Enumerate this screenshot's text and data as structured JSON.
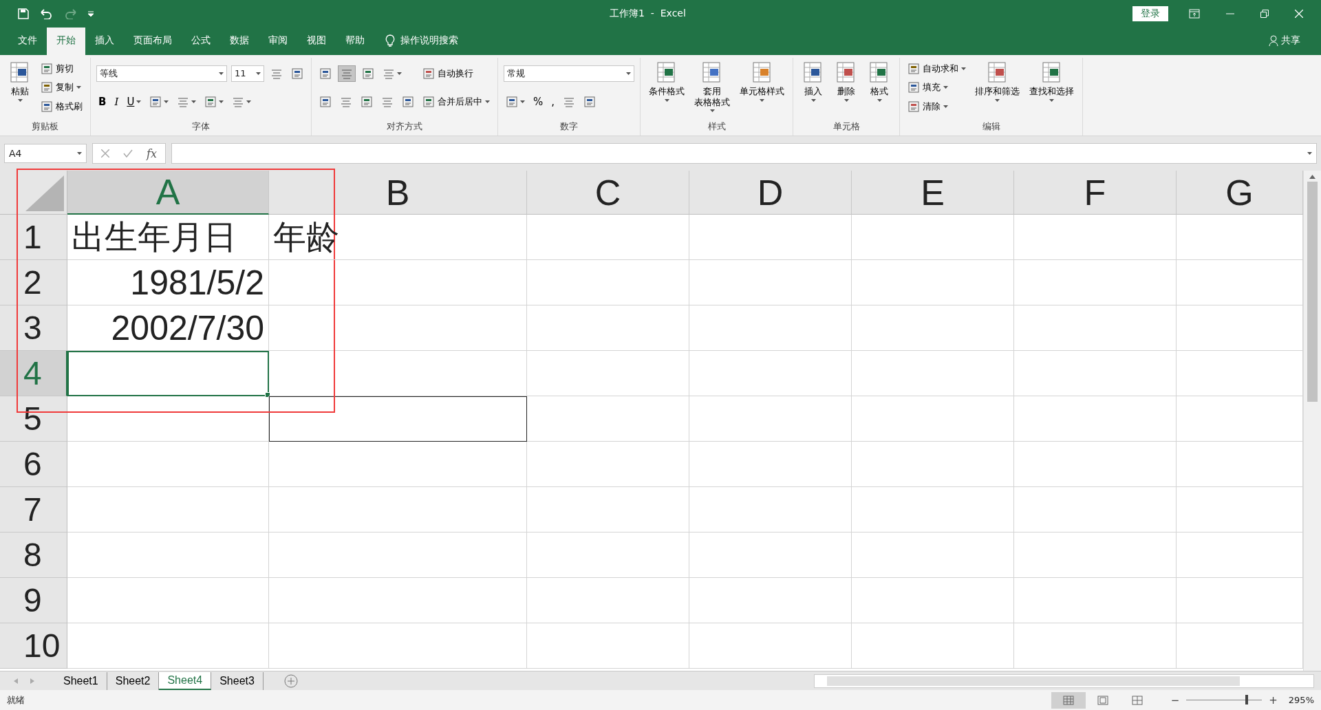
{
  "window": {
    "title": "工作簿1  -  Excel",
    "login": "登录"
  },
  "menu_tabs": [
    {
      "label": "文件",
      "selected": false
    },
    {
      "label": "开始",
      "selected": true
    },
    {
      "label": "插入",
      "selected": false
    },
    {
      "label": "页面布局",
      "selected": false
    },
    {
      "label": "公式",
      "selected": false
    },
    {
      "label": "数据",
      "selected": false
    },
    {
      "label": "审阅",
      "selected": false
    },
    {
      "label": "视图",
      "selected": false
    },
    {
      "label": "帮助",
      "selected": false
    }
  ],
  "tell_me": "操作说明搜索",
  "share": "共享",
  "ribbon": {
    "groups": [
      {
        "label": "剪贴板",
        "sections": [
          {
            "kind": "large",
            "label": "粘贴",
            "dropdown": true
          },
          {
            "kind": "stack",
            "lines": [
              {
                "items": [
                  {
                    "kind": "small",
                    "label": "剪切"
                  }
                ]
              },
              {
                "items": [
                  {
                    "kind": "small",
                    "label": "复制",
                    "dropdown": true
                  }
                ]
              },
              {
                "items": [
                  {
                    "kind": "small",
                    "label": "格式刷"
                  }
                ]
              }
            ]
          }
        ]
      },
      {
        "label": "字体",
        "sections": [
          {
            "kind": "stack",
            "lines": [
              {
                "items": [
                  {
                    "kind": "combo",
                    "label": "等线"
                  },
                  {
                    "kind": "combo-small",
                    "label": "11"
                  },
                  {
                    "kind": "icon"
                  },
                  {
                    "kind": "icon"
                  }
                ]
              },
              {
                "items": [
                  {
                    "kind": "bold",
                    "label": "B"
                  },
                  {
                    "kind": "italic",
                    "label": "I"
                  },
                  {
                    "kind": "underline",
                    "label": "U",
                    "dropdown": true
                  },
                  {
                    "kind": "icon",
                    "dropdown": true
                  },
                  {
                    "kind": "icon",
                    "dropdown": true
                  },
                  {
                    "kind": "icon",
                    "dropdown": true
                  },
                  {
                    "kind": "icon",
                    "dropdown": true
                  }
                ]
              }
            ]
          }
        ]
      },
      {
        "label": "对齐方式",
        "sections": [
          {
            "kind": "stack",
            "lines": [
              {
                "items": [
                  {
                    "kind": "icon",
                    "selected": false
                  },
                  {
                    "kind": "icon",
                    "selected": true
                  },
                  {
                    "kind": "icon",
                    "selected": false
                  },
                  {
                    "kind": "icon",
                    "selected": false,
                    "dropdown": true
                  }
                ]
              },
              {
                "items": [
                  {
                    "kind": "icon",
                    "selected": false
                  },
                  {
                    "kind": "icon",
                    "selected": false
                  },
                  {
                    "kind": "icon",
                    "selected": false
                  },
                  {
                    "kind": "icon",
                    "selected": false
                  },
                  {
                    "kind": "icon",
                    "selected": false
                  }
                ]
              }
            ]
          },
          {
            "kind": "stack",
            "lines": [
              {
                "items": [
                  {
                    "kind": "small",
                    "label": "自动换行"
                  }
                ]
              },
              {
                "items": [
                  {
                    "kind": "small",
                    "label": "合并后居中",
                    "dropdown": true
                  }
                ]
              }
            ]
          }
        ]
      },
      {
        "label": "数字",
        "sections": [
          {
            "kind": "stack",
            "lines": [
              {
                "items": [
                  {
                    "kind": "combo",
                    "label": "常规"
                  }
                ]
              },
              {
                "items": [
                  {
                    "kind": "icon",
                    "dropdown": true
                  },
                  {
                    "kind": "text",
                    "label": "%"
                  },
                  {
                    "kind": "text",
                    "label": ","
                  },
                  {
                    "kind": "icon"
                  },
                  {
                    "kind": "icon"
                  }
                ]
              }
            ]
          }
        ]
      },
      {
        "label": "样式",
        "sections": [
          {
            "kind": "large",
            "label": "条件格式",
            "dropdown": true
          },
          {
            "kind": "large",
            "lines": [
              "套用",
              "表格格式"
            ],
            "dropdown": true
          },
          {
            "kind": "large",
            "label": "单元格样式",
            "dropdown": true
          }
        ]
      },
      {
        "label": "单元格",
        "sections": [
          {
            "kind": "large",
            "label": "插入",
            "dropdown": true
          },
          {
            "kind": "large",
            "label": "删除",
            "dropdown": true
          },
          {
            "kind": "large",
            "label": "格式",
            "dropdown": true
          }
        ]
      },
      {
        "label": "编辑",
        "sections": [
          {
            "kind": "stack",
            "lines": [
              {
                "items": [
                  {
                    "kind": "small",
                    "label": "自动求和",
                    "dropdown": true
                  }
                ]
              },
              {
                "items": [
                  {
                    "kind": "small",
                    "label": "填充",
                    "dropdown": true
                  }
                ]
              },
              {
                "items": [
                  {
                    "kind": "small",
                    "label": "清除",
                    "dropdown": true
                  }
                ]
              }
            ]
          },
          {
            "kind": "large",
            "label": "排序和筛选",
            "dropdown": true
          },
          {
            "kind": "large",
            "label": "查找和选择",
            "dropdown": true
          }
        ]
      }
    ]
  },
  "formula_bar": {
    "name_box": "A4",
    "function_label": "fx"
  },
  "sheet": {
    "columns": [
      {
        "label": "A",
        "selected": true
      },
      {
        "label": "B",
        "selected": false
      },
      {
        "label": "C",
        "selected": false
      },
      {
        "label": "D",
        "selected": false
      },
      {
        "label": "E",
        "selected": false
      },
      {
        "label": "F",
        "selected": false
      },
      {
        "label": "G",
        "selected": false
      }
    ],
    "rows": [
      {
        "label": "1",
        "selected": false,
        "cells": [
          {
            "text": "出生年月日",
            "kind": "text"
          },
          {
            "text": "年龄",
            "kind": "text"
          }
        ]
      },
      {
        "label": "2",
        "selected": false,
        "cells": [
          {
            "text": "1981/5/2",
            "kind": "date"
          }
        ]
      },
      {
        "label": "3",
        "selected": false,
        "cells": [
          {
            "text": "2002/7/30",
            "kind": "date"
          }
        ]
      },
      {
        "label": "4",
        "selected": true,
        "cells": []
      },
      {
        "label": "5",
        "selected": false,
        "cells": []
      },
      {
        "label": "6",
        "selected": false,
        "cells": []
      },
      {
        "label": "7",
        "selected": false,
        "cells": []
      },
      {
        "label": "8",
        "selected": false,
        "cells": []
      },
      {
        "label": "9",
        "selected": false,
        "cells": []
      },
      {
        "label": "10",
        "selected": false,
        "cells": []
      }
    ],
    "highlight_frame": true,
    "outlined_cell": true
  },
  "sheet_tabs": [
    {
      "label": "Sheet1",
      "selected": false
    },
    {
      "label": "Sheet2",
      "selected": false
    },
    {
      "label": "Sheet4",
      "selected": true
    },
    {
      "label": "Sheet3",
      "selected": false
    }
  ],
  "status_bar": {
    "status": "就绪",
    "views": [
      {
        "selected": true
      },
      {
        "selected": false
      },
      {
        "selected": false
      }
    ],
    "zoom": {
      "out": "−",
      "in": "+",
      "level": 0.78,
      "label": "295%"
    }
  }
}
